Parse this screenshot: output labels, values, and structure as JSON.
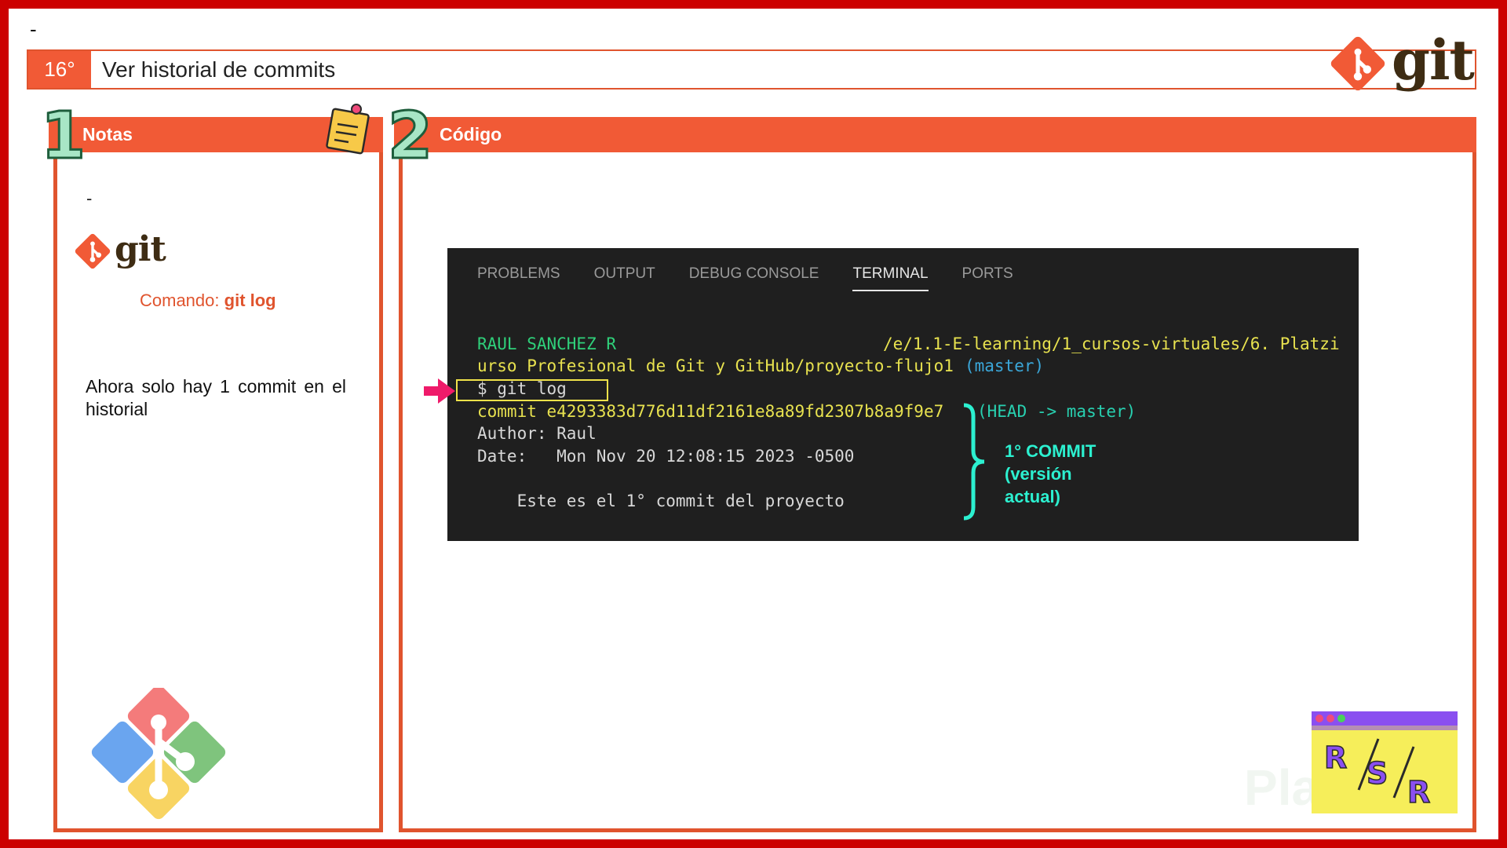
{
  "header": {
    "dash": "-",
    "number": "16°",
    "title": "Ver historial de commits",
    "logo_text": "git"
  },
  "notes": {
    "index": "1",
    "title": "Notas",
    "dash": "-",
    "logo_text": "git",
    "command_label": "Comando:",
    "command_value": "git log",
    "body": "Ahora solo hay 1 commit en el historial"
  },
  "code": {
    "index": "2",
    "title": "Código"
  },
  "terminal": {
    "tabs": [
      {
        "label": "PROBLEMS",
        "active": false
      },
      {
        "label": "OUTPUT",
        "active": false
      },
      {
        "label": "DEBUG CONSOLE",
        "active": false
      },
      {
        "label": "TERMINAL",
        "active": true
      },
      {
        "label": "PORTS",
        "active": false
      }
    ],
    "prompt_user": "RAUL SANCHEZ R",
    "prompt_path": "/e/1.1-E-learning/1_cursos-virtuales/6. Platzi",
    "prompt_path_cont": "urso Profesional de Git y GitHub/proyecto-flujo1",
    "prompt_branch": "(master)",
    "command": "$ git log",
    "commit_line": "commit e4293383d776d11df2161e8a89fd2307b8a9f9e7",
    "commit_ref": "(HEAD -> master)",
    "author_line": "Author: Raul",
    "date_line": "Date:   Mon Nov 20 12:08:15 2023 -0500",
    "message_line": "    Este es el 1° commit del proyecto"
  },
  "annotation": {
    "line1": "1°  COMMIT",
    "line2": "(versión",
    "line3": "actual)"
  },
  "badge": {
    "text_r1": "R",
    "text_s": "S",
    "text_r2": "R"
  },
  "watermark": "Platzi",
  "colors": {
    "accent": "#f15a36",
    "frame": "#cc0000",
    "git_brown": "#3e2c13",
    "terminal_bg": "#1f1f1f",
    "annotation": "#2cf0d0"
  }
}
